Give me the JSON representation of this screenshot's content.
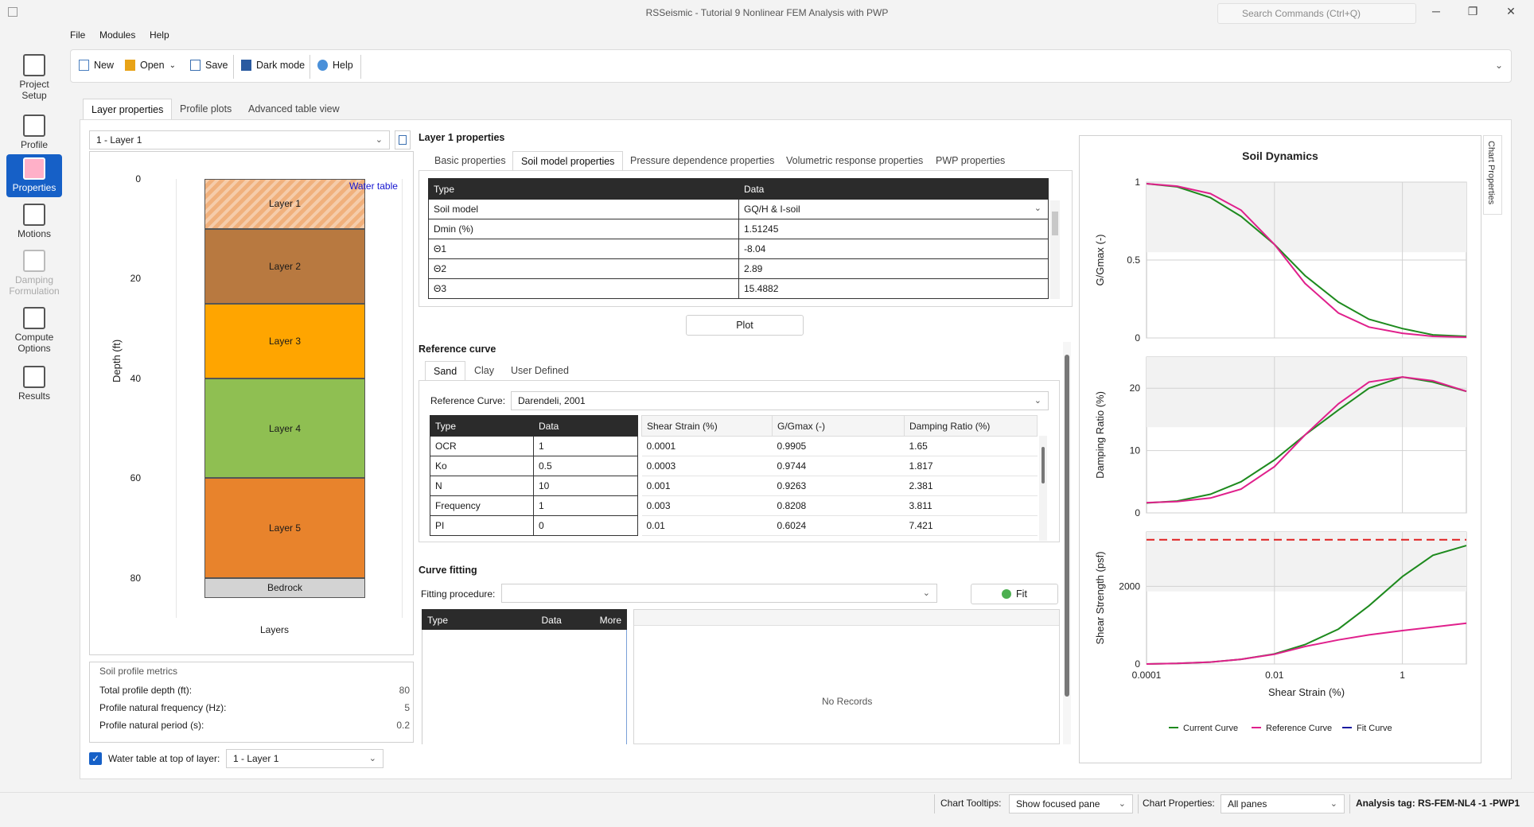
{
  "window": {
    "title": "RSSeismic - Tutorial 9 Nonlinear FEM Analysis with PWP",
    "search_placeholder": "Search Commands (Ctrl+Q)"
  },
  "menu": [
    "File",
    "Modules",
    "Help"
  ],
  "toolbar": {
    "new": "New",
    "open": "Open",
    "save": "Save",
    "dark_mode": "Dark mode",
    "help": "Help"
  },
  "rail": [
    {
      "name": "project-setup",
      "label": "Project Setup"
    },
    {
      "name": "profile",
      "label": "Profile"
    },
    {
      "name": "properties",
      "label": "Properties",
      "active": true
    },
    {
      "name": "motions",
      "label": "Motions"
    },
    {
      "name": "damping-formulation",
      "label": "Damping Formulation",
      "disabled": true
    },
    {
      "name": "compute-options",
      "label": "Compute Options"
    },
    {
      "name": "results",
      "label": "Results"
    }
  ],
  "main_tabs": [
    "Layer properties",
    "Profile plots",
    "Advanced table view"
  ],
  "layer_select": "1 - Layer 1",
  "profile": {
    "ylabel": "Depth (ft)",
    "xlabel": "Layers",
    "water_table_label": "Water table",
    "ticks": [
      "0",
      "20",
      "40",
      "60",
      "80"
    ],
    "layers": [
      {
        "label": "Layer 1",
        "top": 0,
        "bottom": 10,
        "color": "#f0b07c",
        "hatched": true
      },
      {
        "label": "Layer 2",
        "top": 10,
        "bottom": 25,
        "color": "#b87940"
      },
      {
        "label": "Layer 3",
        "top": 25,
        "bottom": 40,
        "color": "#ffa500"
      },
      {
        "label": "Layer 4",
        "top": 40,
        "bottom": 60,
        "color": "#8fbf52"
      },
      {
        "label": "Layer 5",
        "top": 60,
        "bottom": 80,
        "color": "#e8832c"
      },
      {
        "label": "Bedrock",
        "top": 80,
        "bottom": 84,
        "color": "#d3d3d3"
      }
    ]
  },
  "metrics": {
    "title": "Soil profile metrics",
    "rows": [
      {
        "label": "Total profile depth (ft):",
        "value": "80"
      },
      {
        "label": "Profile natural frequency (Hz):",
        "value": "5"
      },
      {
        "label": "Profile natural period (s):",
        "value": "0.2"
      }
    ]
  },
  "water_table": {
    "label": "Water table at top of layer:",
    "value": "1 - Layer 1"
  },
  "props": {
    "title": "Layer 1 properties",
    "tabs": [
      "Basic properties",
      "Soil model properties",
      "Pressure dependence properties",
      "Volumetric response properties",
      "PWP properties"
    ],
    "headers": [
      "Type",
      "Data"
    ],
    "rows": [
      {
        "type": "Soil model",
        "data": "GQ/H & I-soil"
      },
      {
        "type": "Dmin (%)",
        "data": "1.51245"
      },
      {
        "type": "Θ1",
        "data": "-8.04"
      },
      {
        "type": "Θ2",
        "data": "2.89"
      },
      {
        "type": "Θ3",
        "data": "15.4882"
      }
    ],
    "plot_button": "Plot"
  },
  "reference": {
    "title": "Reference curve",
    "tabs": [
      "Sand",
      "Clay",
      "User Defined"
    ],
    "curve_label": "Reference Curve:",
    "curve_value": "Darendeli, 2001",
    "param_headers": [
      "Type",
      "Data"
    ],
    "params": [
      {
        "type": "OCR",
        "data": "1"
      },
      {
        "type": "Ko",
        "data": "0.5"
      },
      {
        "type": "N",
        "data": "10"
      },
      {
        "type": "Frequency",
        "data": "1"
      },
      {
        "type": "PI",
        "data": "0"
      }
    ],
    "curve_headers": [
      "Shear Strain (%)",
      "G/Gmax (-)",
      "Damping Ratio (%)"
    ],
    "curve_rows": [
      [
        "0.0001",
        "0.9905",
        "1.65"
      ],
      [
        "0.0003",
        "0.9744",
        "1.817"
      ],
      [
        "0.001",
        "0.9263",
        "2.381"
      ],
      [
        "0.003",
        "0.8208",
        "3.811"
      ],
      [
        "0.01",
        "0.6024",
        "7.421"
      ]
    ]
  },
  "fitting": {
    "title": "Curve fitting",
    "procedure_label": "Fitting procedure:",
    "fit_button": "Fit",
    "headers": [
      "Type",
      "Data",
      "More"
    ],
    "empty": "No Records"
  },
  "chart_data": {
    "type": "line",
    "title": "Soil Dynamics",
    "xlabel": "Shear Strain (%)",
    "x_scale": "log",
    "x_ticks": [
      "0.0001",
      "0.01",
      "1"
    ],
    "legend": [
      "Current Curve",
      "Reference Curve",
      "Fit Curve"
    ],
    "legend_colors": [
      "#1e8a1e",
      "#e0208c",
      "#1a1aa0"
    ],
    "panels": [
      {
        "ylabel": "G/Gmax (-)",
        "ylim": [
          0,
          1
        ],
        "y_ticks": [
          "0",
          "0.5",
          "1"
        ],
        "x": [
          0.0001,
          0.0003,
          0.001,
          0.003,
          0.01,
          0.03,
          0.1,
          0.3,
          1,
          3,
          10
        ],
        "series": [
          {
            "name": "Current Curve",
            "values": [
              0.99,
              0.97,
              0.9,
              0.78,
              0.6,
              0.4,
              0.23,
              0.12,
              0.06,
              0.02,
              0.01
            ]
          },
          {
            "name": "Reference Curve",
            "values": [
              0.99,
              0.974,
              0.926,
              0.82,
              0.6,
              0.35,
              0.16,
              0.07,
              0.03,
              0.01,
              0.005
            ]
          }
        ]
      },
      {
        "ylabel": "Damping Ratio (%)",
        "ylim": [
          0,
          25
        ],
        "y_ticks": [
          "0",
          "10",
          "20"
        ],
        "x": [
          0.0001,
          0.0003,
          0.001,
          0.003,
          0.01,
          0.03,
          0.1,
          0.3,
          1,
          3,
          10
        ],
        "series": [
          {
            "name": "Current Curve",
            "values": [
              1.6,
              1.9,
              3.0,
              5.0,
              8.5,
              12.5,
              16.5,
              20,
              21.8,
              21,
              19.5
            ]
          },
          {
            "name": "Reference Curve",
            "values": [
              1.65,
              1.817,
              2.381,
              3.811,
              7.421,
              12.5,
              17.5,
              21,
              21.8,
              21.2,
              19.5
            ]
          }
        ]
      },
      {
        "ylabel": "Shear Strength (psf)",
        "ylim": [
          0,
          3400
        ],
        "y_ticks": [
          "0",
          "2000"
        ],
        "x": [
          0.0001,
          0.0003,
          0.001,
          0.003,
          0.01,
          0.03,
          0.1,
          0.3,
          1,
          3,
          10
        ],
        "reference_line": 3200,
        "series": [
          {
            "name": "Current Curve",
            "values": [
              0,
              15,
              50,
              120,
              260,
              500,
              900,
              1500,
              2250,
              2800,
              3050
            ]
          },
          {
            "name": "Reference Curve",
            "values": [
              0,
              15,
              50,
              120,
              250,
              450,
              620,
              750,
              860,
              950,
              1050
            ]
          }
        ]
      }
    ]
  },
  "status": {
    "tooltips_label": "Chart Tooltips:",
    "tooltips_value": "Show focused pane",
    "properties_label": "Chart Properties:",
    "properties_value": "All panes",
    "analysis_tag": "Analysis tag: RS-FEM-NL4 -1 -PWP1"
  }
}
